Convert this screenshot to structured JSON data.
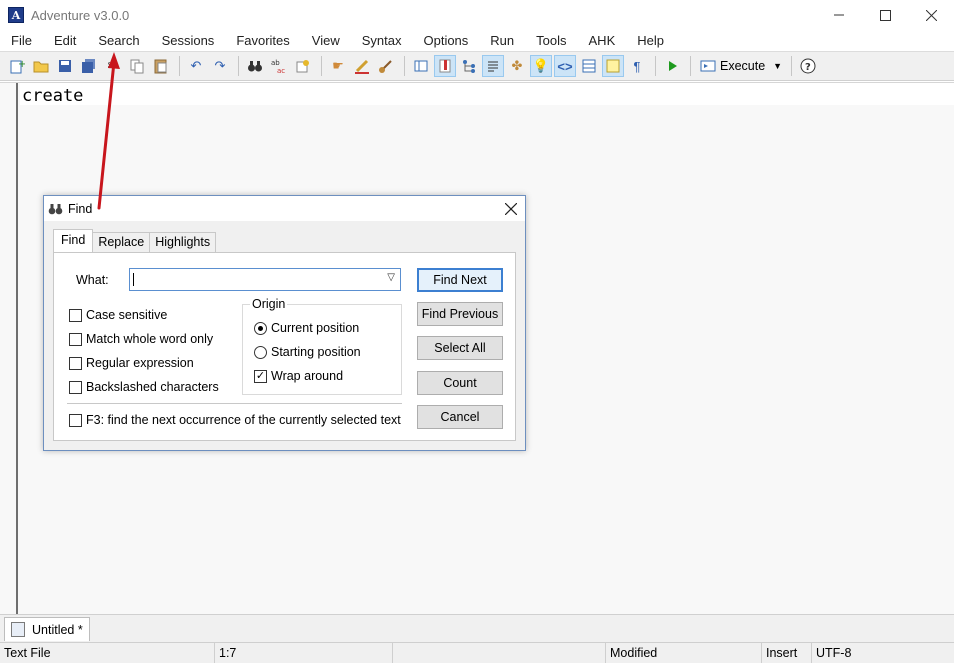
{
  "window": {
    "title": "Adventure v3.0.0",
    "app_icon_letter": "A"
  },
  "menu": [
    "File",
    "Edit",
    "Search",
    "Sessions",
    "Favorites",
    "View",
    "Syntax",
    "Options",
    "Run",
    "Tools",
    "AHK",
    "Help"
  ],
  "toolbar": {
    "execute_label": "Execute"
  },
  "editor": {
    "text": "create"
  },
  "doc_tab": {
    "label": "Untitled  *"
  },
  "status": {
    "file_type": "Text File",
    "position": "1:7",
    "modified": "Modified",
    "mode": "Insert",
    "encoding": "UTF-8"
  },
  "find": {
    "title": "Find",
    "tabs": [
      "Find",
      "Replace",
      "Highlights"
    ],
    "what_label": "What:",
    "what_value": "",
    "options": {
      "case_sensitive": "Case sensitive",
      "whole_word": "Match whole word only",
      "regex": "Regular expression",
      "backslashed": "Backslashed characters"
    },
    "origin": {
      "legend": "Origin",
      "current": "Current position",
      "starting": "Starting position",
      "wrap": "Wrap around"
    },
    "f3_hint": "F3: find the next occurrence of the currently selected text",
    "buttons": {
      "find_next": "Find Next",
      "find_previous": "Find Previous",
      "select_all": "Select All",
      "count": "Count",
      "cancel": "Cancel"
    }
  },
  "colors": {
    "accent": "#3c7fd1",
    "annotation": "#c8161d"
  }
}
